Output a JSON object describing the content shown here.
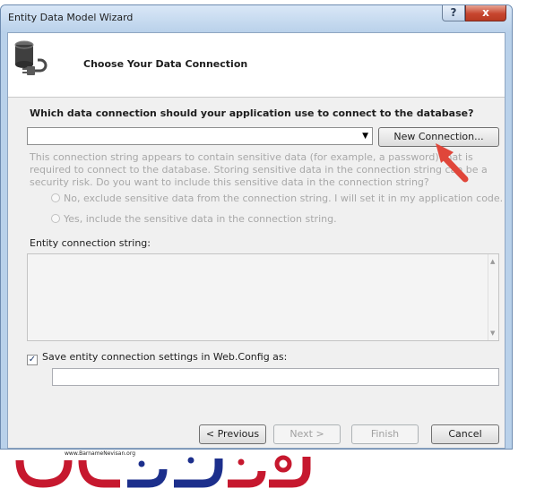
{
  "window": {
    "title": "Entity Data Model Wizard",
    "help_glyph": "?",
    "close_glyph": "x"
  },
  "header": {
    "icon": "database-connection-icon",
    "step_title": "Choose Your Data Connection"
  },
  "connection": {
    "question": "Which data connection should your application use to connect to the database?",
    "selected_value": "",
    "new_connection_label": "New Connection..."
  },
  "sensitive": {
    "warning": "This connection string appears to contain sensitive data (for example, a password) that is required to connect to the database. Storing sensitive data in the connection string can be a security risk. Do you want to include this sensitive data in the connection string?",
    "option_no": "No, exclude sensitive data from the connection string. I will set it in my application code.",
    "option_yes": "Yes, include the sensitive data in the connection string."
  },
  "entity_connection": {
    "label": "Entity connection string:",
    "value": ""
  },
  "save_settings": {
    "label": "Save entity connection settings in Web.Config as:",
    "checked": true,
    "value": ""
  },
  "buttons": {
    "previous": "< Previous",
    "next": "Next >",
    "finish": "Finish",
    "cancel": "Cancel"
  },
  "watermark": {
    "url": "www.BarnameNevisan.org",
    "logo_colors": [
      "#c6182e",
      "#1c2f8c"
    ]
  },
  "colors": {
    "window_frame": "#b9d1ea",
    "close_button": "#c7462f",
    "annotation_arrow": "#e0463a"
  }
}
